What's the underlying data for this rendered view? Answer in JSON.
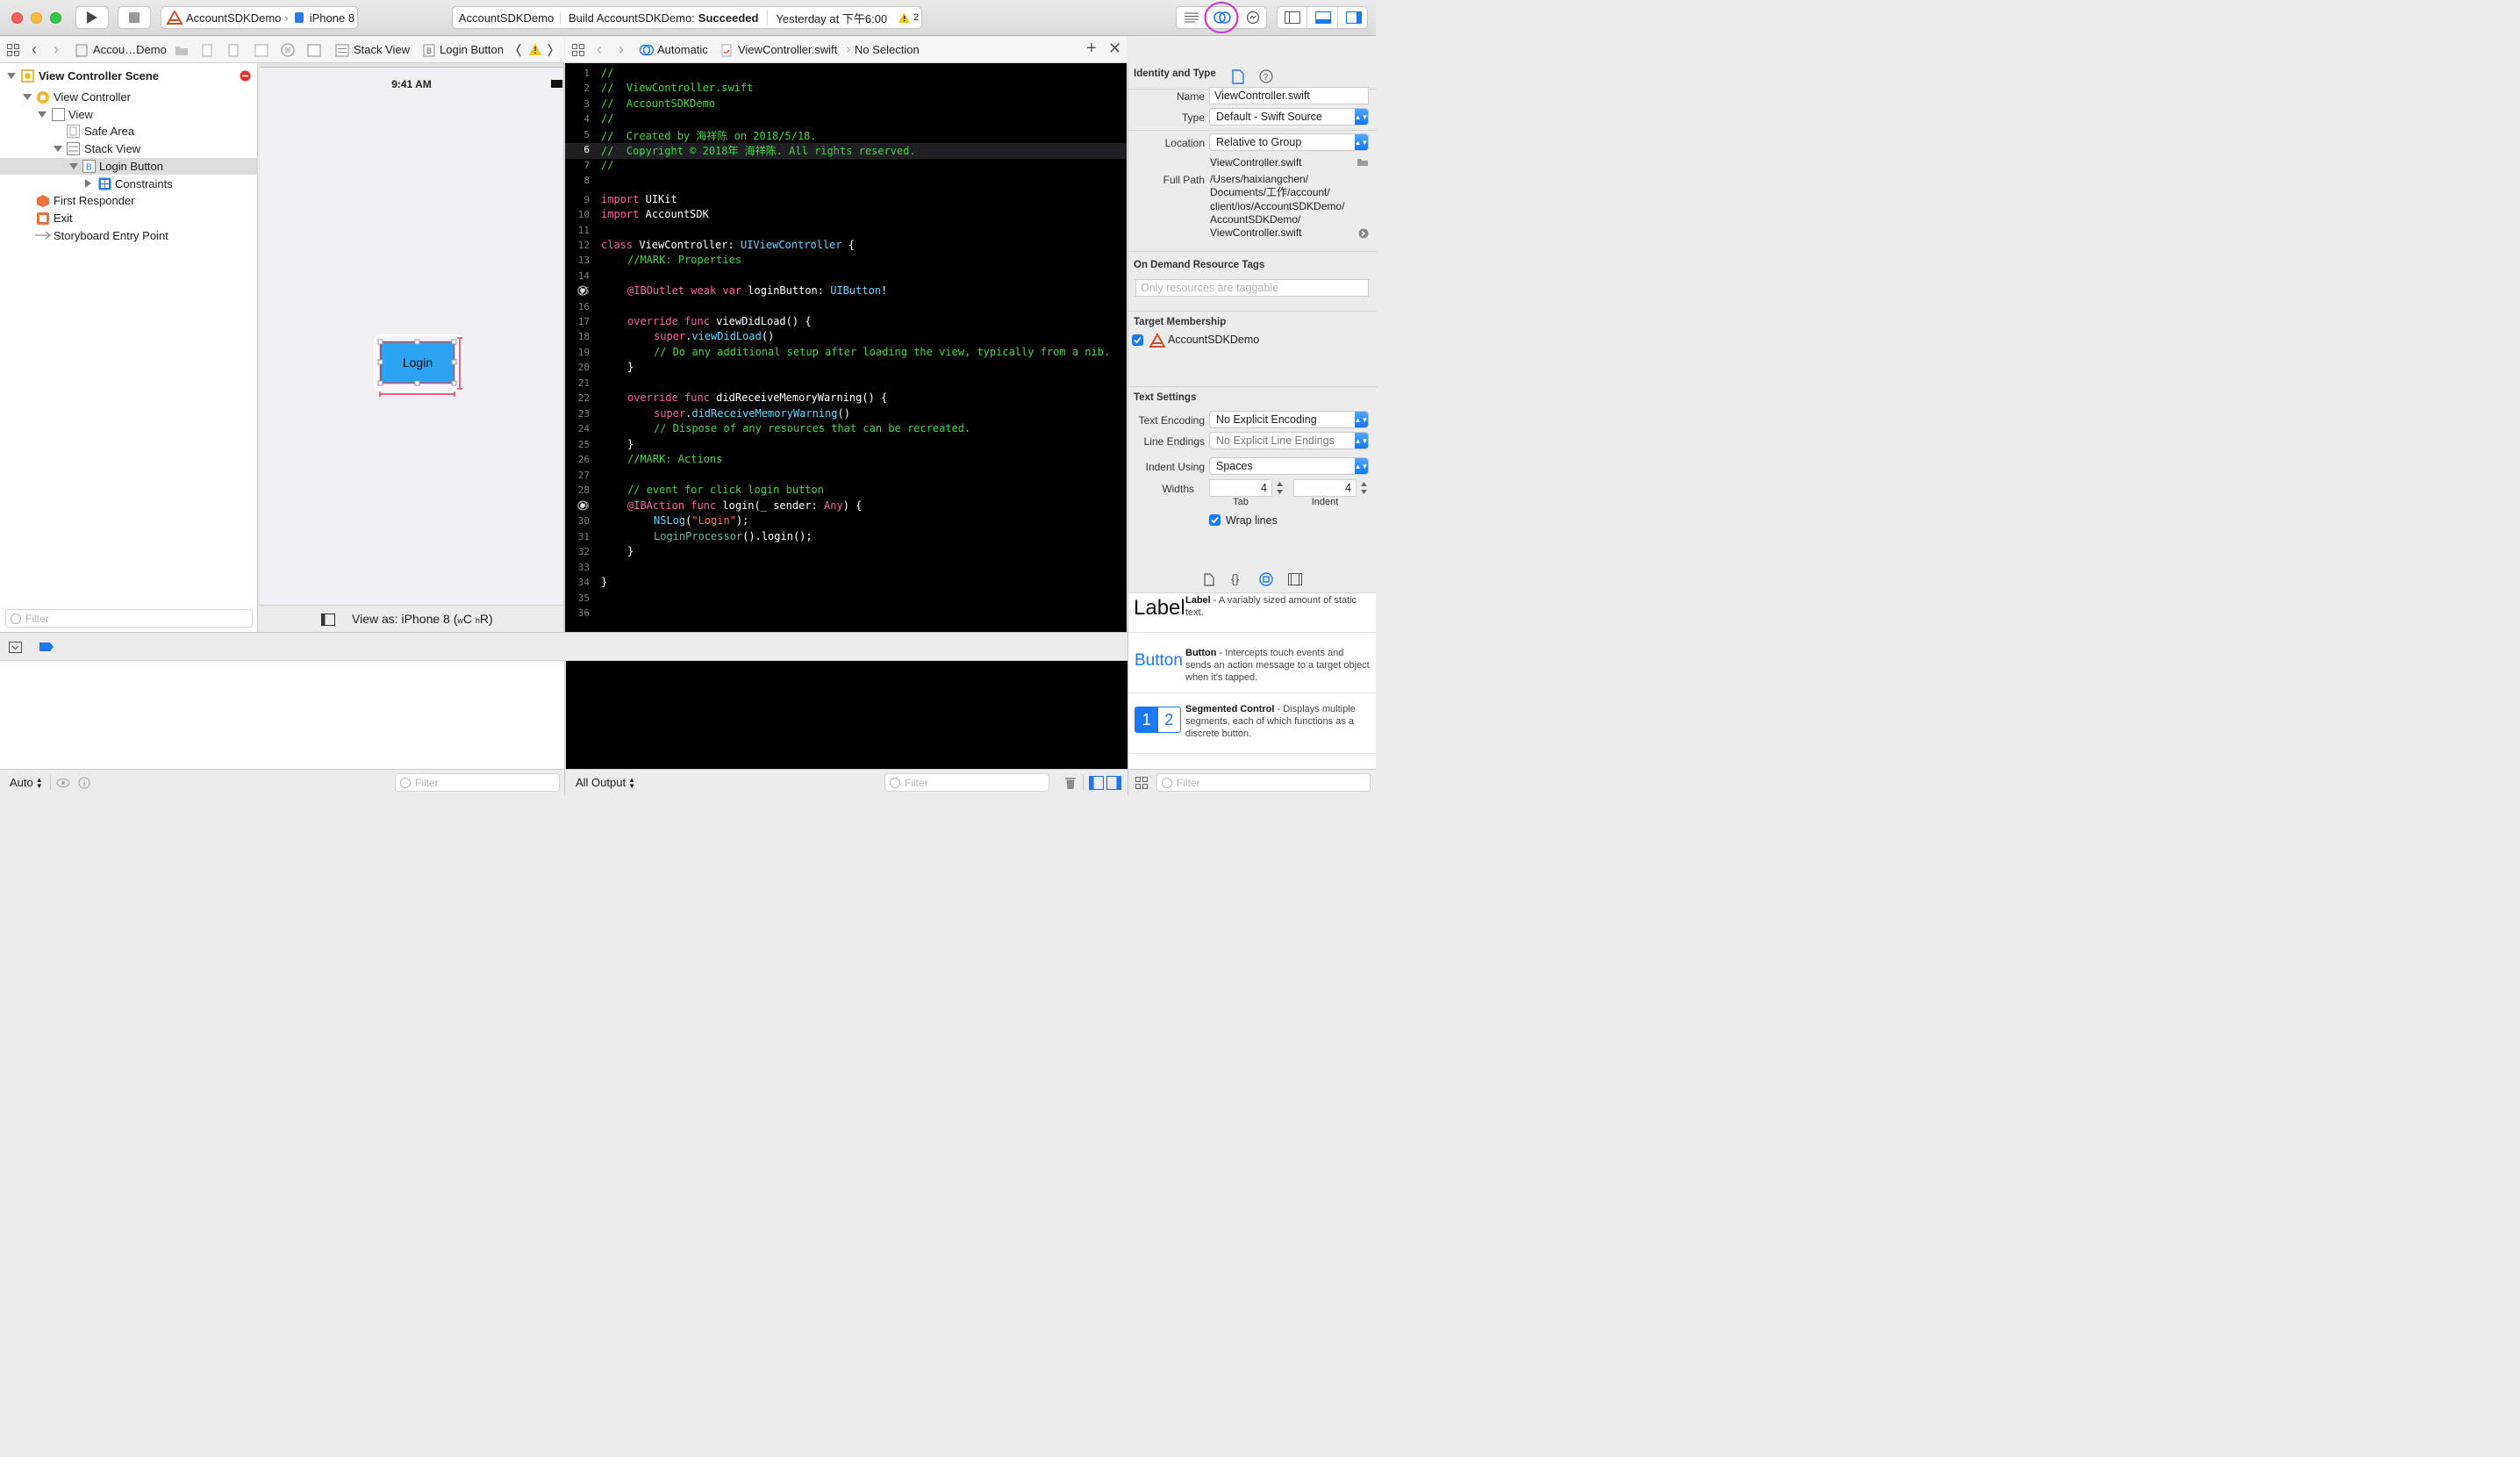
{
  "toolbar": {
    "scheme": "AccountSDKDemo",
    "device": "iPhone 8",
    "activity_app": "AccountSDKDemo",
    "activity_status_prefix": "Build AccountSDKDemo:",
    "activity_status": "Succeeded",
    "activity_time": "Yesterday at 下午6:00",
    "warning_count": "2"
  },
  "ib_jumpbar": {
    "crumbs": [
      "Accou…Demo",
      "Stack View",
      "Login Button"
    ]
  },
  "editor_jumpbar": {
    "mode": "Automatic",
    "file": "ViewController.swift",
    "selection": "No Selection"
  },
  "outline": {
    "scene": "View Controller Scene",
    "items": [
      "View Controller",
      "View",
      "Safe Area",
      "Stack View",
      "Login Button",
      "Constraints",
      "First Responder",
      "Exit",
      "Storyboard Entry Point"
    ]
  },
  "canvas": {
    "status_time": "9:41 AM",
    "button_label": "Login",
    "view_as_prefix": "View as: iPhone 8 (",
    "view_as_w": "w",
    "view_as_c": "C",
    "view_as_h": "h",
    "view_as_r": "R",
    "view_as_suffix": ")"
  },
  "code": {
    "line_numbers": [
      "1",
      "2",
      "3",
      "4",
      "5",
      "6",
      "7",
      "8",
      "9",
      "10",
      "11",
      "12",
      "13",
      "14",
      "15",
      "16",
      "17",
      "18",
      "19",
      "20",
      "21",
      "22",
      "23",
      "24",
      "25",
      "26",
      "27",
      "28",
      "29",
      "30",
      "31",
      "32",
      "33",
      "34",
      "35",
      "36"
    ],
    "l1": "//",
    "l2": "//  ViewController.swift",
    "l3": "//  AccountSDKDemo",
    "l4": "//",
    "l5": "//  Created by 海祥陈 on 2018/5/18.",
    "l6": "//  Copyright © 2018年 海祥陈. All rights reserved.",
    "l7": "//",
    "kw_import": "import",
    "mod_uikit": "UIKit",
    "mod_sdk": "AccountSDK",
    "kw_class": "class",
    "cls_name": "ViewController:",
    "cls_super": "UIViewController",
    "brace_open": "{",
    "brace_close": "}",
    "mark_props": "//MARK: Properties",
    "iboutlet": "@IBOutlet",
    "weak_var": "weak var",
    "outlet_name": "loginButton:",
    "uibutton": "UIButton",
    "bang": "!",
    "kw_override": "override",
    "kw_func": "func",
    "fn_viewdidload": "viewDidLoad() {",
    "kw_super": "super",
    "dot": ".",
    "call_viewdidload": "viewDidLoad",
    "parens": "()",
    "cmt_setup": "// Do any additional setup after loading the view, typically from a nib.",
    "fn_memwarn": "didReceiveMemoryWarning() {",
    "call_memwarn": "didReceiveMemoryWarning",
    "cmt_dispose": "// Dispose of any resources that can be recreated.",
    "mark_actions": "//MARK: Actions",
    "cmt_event": "// event for click login button",
    "ibaction": "@IBAction",
    "fn_login": "login(_ sender:",
    "kw_any": "Any",
    "paren_brace": ") {",
    "nslog": "NSLog",
    "lp": "(",
    "str_login": "\"Login\"",
    "rp_semi": ");",
    "processor": "LoginProcessor",
    "processor_rest": "().login();"
  },
  "inspector": {
    "identity_title": "Identity and Type",
    "name_label": "Name",
    "name_value": "ViewController.swift",
    "type_label": "Type",
    "type_value": "Default - Swift Source",
    "location_label": "Location",
    "location_value": "Relative to Group",
    "location_file": "ViewController.swift",
    "fullpath_label": "Full Path",
    "fullpath_lines": [
      "/Users/haixiangchen/",
      "Documents/工作/account/",
      "client/ios/AccountSDKDemo/",
      "AccountSDKDemo/",
      "ViewController.swift"
    ],
    "ondemand_title": "On Demand Resource Tags",
    "ondemand_placeholder": "Only resources are taggable",
    "target_title": "Target Membership",
    "target_name": "AccountSDKDemo",
    "text_title": "Text Settings",
    "encoding_label": "Text Encoding",
    "encoding_value": "No Explicit Encoding",
    "endings_label": "Line Endings",
    "endings_value": "No Explicit Line Endings",
    "indent_label": "Indent Using",
    "indent_value": "Spaces",
    "widths_label": "Widths",
    "tab_value": "4",
    "indent_width_value": "4",
    "tab_caption": "Tab",
    "indent_caption": "Indent",
    "wrap_label": "Wrap lines"
  },
  "library": {
    "items": [
      {
        "preview": "Label",
        "name": "Label",
        "desc": " - A variably sized amount of static text."
      },
      {
        "preview": "Button",
        "name": "Button",
        "desc": " - Intercepts touch events and sends an action message to a target object when it's tapped."
      },
      {
        "preview1": "1",
        "preview2": "2",
        "name": "Segmented Control",
        "desc": " - Displays multiple segments, each of which functions as a discrete button."
      }
    ]
  },
  "bottom": {
    "auto_label": "Auto",
    "filter_placeholder": "Filter",
    "output_label": "All Output"
  },
  "colors": {
    "accent": "#1d77f2",
    "highlight_circle": "#cc3ec4",
    "login_button": "#2ba3ee",
    "code_comment": "#41d345",
    "code_keyword": "#fc5fa3",
    "code_type": "#5dd8ff"
  }
}
